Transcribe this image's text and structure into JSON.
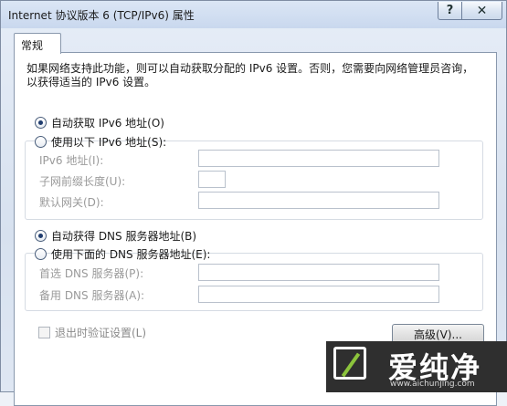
{
  "window": {
    "title": "Internet 协议版本 6 (TCP/IPv6) 属性",
    "help_label": "?",
    "close_label": "✕"
  },
  "tabs": [
    {
      "label": "常规"
    }
  ],
  "description": "如果网络支持此功能，则可以自动获取分配的 IPv6 设置。否则，您需要向网络管理员咨询，以获得适当的 IPv6 设置。",
  "ip_section": {
    "auto_label": "自动获取 IPv6 地址(O)",
    "manual_label": "使用以下 IPv6 地址(S):",
    "auto_selected": true,
    "fields": [
      {
        "label": "IPv6 地址(I):",
        "value": ""
      },
      {
        "label": "子网前缀长度(U):",
        "value": ""
      },
      {
        "label": "默认网关(D):",
        "value": ""
      }
    ]
  },
  "dns_section": {
    "auto_label": "自动获得 DNS 服务器地址(B)",
    "manual_label": "使用下面的 DNS 服务器地址(E):",
    "auto_selected": true,
    "fields": [
      {
        "label": "首选 DNS 服务器(P):",
        "value": ""
      },
      {
        "label": "备用 DNS 服务器(A):",
        "value": ""
      }
    ]
  },
  "validate_on_exit": {
    "label": "退出时验证设置(L)",
    "checked": false,
    "enabled": false
  },
  "advanced_button": "高级(V)...",
  "watermark": {
    "name": "爱纯净",
    "url": "www.aichunjing.com",
    "logo_icon": "logo-mark-icon"
  }
}
